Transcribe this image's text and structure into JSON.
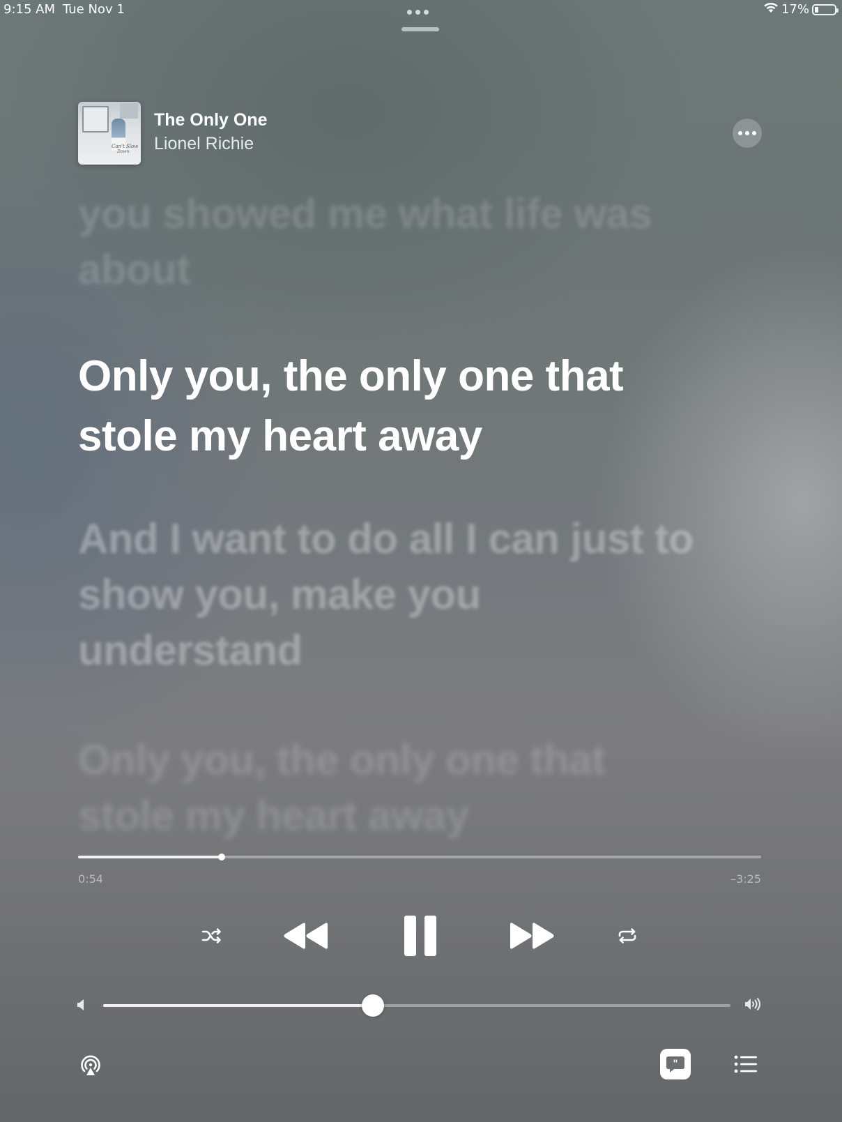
{
  "status_bar": {
    "time": "9:15 AM",
    "date": "Tue Nov 1",
    "battery_percent": "17%",
    "battery_level": 0.17,
    "wifi_icon": "wifi-icon",
    "battery_icon": "battery-icon"
  },
  "now_playing": {
    "title": "The Only One",
    "artist": "Lionel Richie",
    "artwork_text": [
      "Can't Slow",
      "Down"
    ],
    "more_icon": "ellipsis-icon"
  },
  "lyrics": {
    "previous": "you showed me what life was about",
    "current": "Only you, the only one that stole my heart away",
    "next": "And I want to do all I can just to show you, make you understand",
    "later": "Only you, the only one that stole my heart away"
  },
  "playback": {
    "elapsed": "0:54",
    "remaining": "–3:25",
    "progress": 0.21,
    "state": "playing"
  },
  "controls": {
    "shuffle_icon": "shuffle-icon",
    "rewind_icon": "rewind-icon",
    "pause_icon": "pause-icon",
    "forward_icon": "fast-forward-icon",
    "repeat_icon": "repeat-icon"
  },
  "volume": {
    "level": 0.43,
    "low_icon": "volume-low-icon",
    "high_icon": "volume-high-icon"
  },
  "bottom_bar": {
    "airplay_icon": "airplay-icon",
    "lyrics_icon": "lyrics-quote-icon",
    "lyrics_active": true,
    "queue_icon": "queue-list-icon"
  },
  "colors": {
    "text": "#ffffff",
    "dim_lyric": "rgba(255,255,255,0.32)"
  }
}
